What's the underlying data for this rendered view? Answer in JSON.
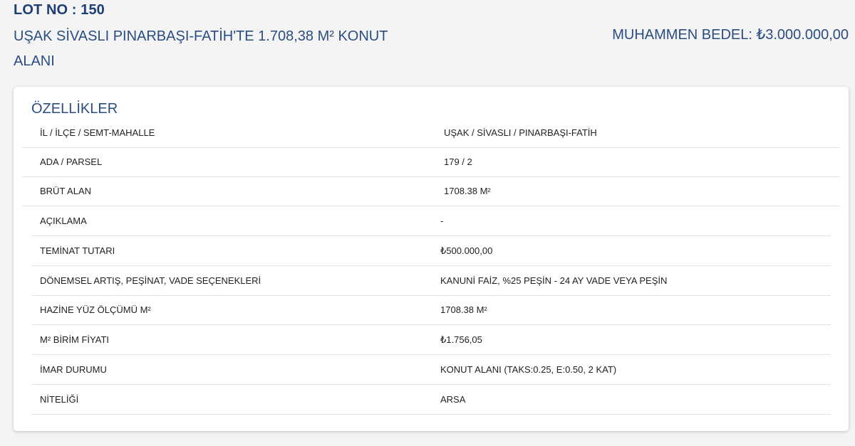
{
  "header": {
    "lot_no": "LOT NO : 150",
    "title": "UŞAK SİVASLI PINARBAŞI-FATİH'TE 1.708,38 M² KONUT ALANI",
    "price": "MUHAMMEN BEDEL: ₺3.000.000,00"
  },
  "features": {
    "title": "ÖZELLİKLER",
    "rows": [
      {
        "label": "İL / İLÇE / SEMT-MAHALLE",
        "value": "UŞAK / SİVASLI / PINARBAŞI-FATİH"
      },
      {
        "label": "ADA / PARSEL",
        "value": "179 / 2"
      },
      {
        "label": "BRÜT ALAN",
        "value": "1708.38 M²"
      },
      {
        "label": "AÇIKLAMA",
        "value": "-"
      },
      {
        "label": "TEMİNAT TUTARI",
        "value": "₺500.000,00"
      },
      {
        "label": "DÖNEMSEL ARTIŞ, PEŞİNAT, VADE SEÇENEKLERİ",
        "value": "KANUNİ FAİZ, %25 PEŞİN - 24 AY VADE VEYA PEŞİN"
      },
      {
        "label": "HAZİNE YÜZ ÖLÇÜMÜ M²",
        "value": "1708.38 M²"
      },
      {
        "label": "M² BİRİM FİYATI",
        "value": "₺1.756,05"
      },
      {
        "label": "İMAR DURUMU",
        "value": "KONUT ALANI (TAKS:0.25, E:0.50, 2 KAT)"
      },
      {
        "label": "NİTELİĞİ",
        "value": "ARSA"
      }
    ]
  }
}
